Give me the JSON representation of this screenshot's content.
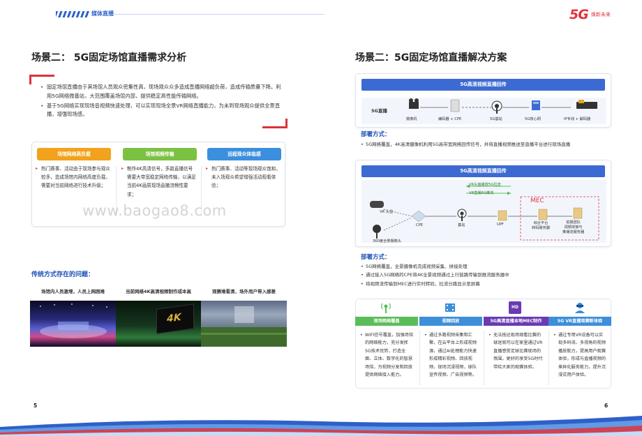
{
  "header": {
    "section_tag": "媒体直播",
    "logo_mark": "5G",
    "logo_slogan": "焕新未来"
  },
  "left": {
    "title": "场景二：  5G固定场馆直播需求分析",
    "intro": [
      "固定场馆直播由于其场馆人员观众密集性高，现场观众众多造成直播网络超负荷，造成传输质量下降。利用5G网络微基站，大范围覆盖场馆内部，提供稳定高性能传输网络。",
      "基于5G网络实现现场音视频快速处理，可以实现现场全景VR网络直播能力，为未到现场观众提供全景直播，增强现场感。"
    ],
    "features": [
      {
        "label": "场馆网络高负载",
        "text": "热门赛事、活动由于现场参与观众较多，造成场馆内网络高度负载，需要对当前网络进行技术升级；",
        "color": "#f2a21c"
      },
      {
        "label": "场馆视频传输",
        "text": "制作4K高清信号，多路直播信号需要大带宽稳定网络传输，以满足当前4K画质现场直播流畅性要求；",
        "color": "#7cc242"
      },
      {
        "label": "远程观众体临感",
        "text": "热门赛事、活动等现场观众饱和，未入场观众希望增强活动观看体验；",
        "color": "#3b8fde"
      }
    ],
    "watermark": "www.baogao8.com",
    "problems_title": "传统方式存在的问题：",
    "problems": [
      "场馆内人员激增，人员上网困难",
      "当前网络4K高清视频制作成本高",
      "观赛难看清，场外用户带入感差"
    ],
    "screen_text": "4K",
    "page_number": "5"
  },
  "right": {
    "title": "场景二：5G固定场馆直播解决方案",
    "panel1": {
      "header": "5G高清视频直播回传",
      "row_label": "5G直播",
      "devices": [
        "摄像机",
        "编码器 + CPE",
        "5G基站",
        "5G核心网",
        "IP专线 + 解码器"
      ]
    },
    "method1_title": "部署方式：",
    "method1": [
      "5G网络覆盖，4K高清摄像机利用5G高带宽网络回传信号，并将直播视频推送至直播平台进行现场直播"
    ],
    "panel2": {
      "header": "5G高清视频直播回传",
      "arrow_down": "VR头盔播放5G拉流",
      "arrow_up": "VR直播5G推流",
      "mec": "MEC",
      "nodes": [
        "VR 头显",
        "CPE",
        "基站",
        "UPF",
        "综合平台\n转码服务器",
        "拍摄团队\n视频拼接与\n推播流服务器",
        "360度全景摄像头"
      ]
    },
    "method2_title": "部署方式：",
    "method2": [
      "5G网络覆盖，全景摄像机完成视频采集、拼接处理",
      "通过接入5G网络的CPE将4K全景视频通过上行链路传输到推流服务器中",
      "将视频流传输到MEC进行实时转码，拉流分路显示至屏幕"
    ],
    "cards": [
      {
        "label": "现场网络覆盖",
        "color": "#5bbd5a",
        "text": "WIFI信号覆盖，加强场馆的网络能力，充分发挥5G技术优势，打造全面、立体、数字化的智慧场馆，为视频分发和回放提供网络接入能力。"
      },
      {
        "label": "视频回放",
        "color": "#3c8fd8",
        "text": "通过多路视频采集和汇聚，在云平台上形成视频源，通过AI处理能力快速形成精彩视频、回放视频，现场沉浸视频，球队宣传视频、广告视频等。"
      },
      {
        "label": "5G高清直播本地MEC制作",
        "color": "#6a3bb2",
        "text": "无法抵达现场观看比赛的球迷就可以在家里通过VR直播感受足球比赛现场的氛围，更好的享受5G时代带给大家的观赛体验。"
      },
      {
        "label": "5G VR直播观赛新体验",
        "color": "#3c8fd8",
        "text": "通过专用VR设备可以实现多码流、多视角的视频播放能力，提高用户观赛体验，形成与直播视频的差异化服务能力，提升沉浸式用户体验。"
      }
    ],
    "hd_badge": "HD",
    "page_number": "6"
  },
  "colors": {
    "brand_blue": "#1a4fb5",
    "accent_red": "#e2343c",
    "panel_blue": "#3c6ad2"
  }
}
